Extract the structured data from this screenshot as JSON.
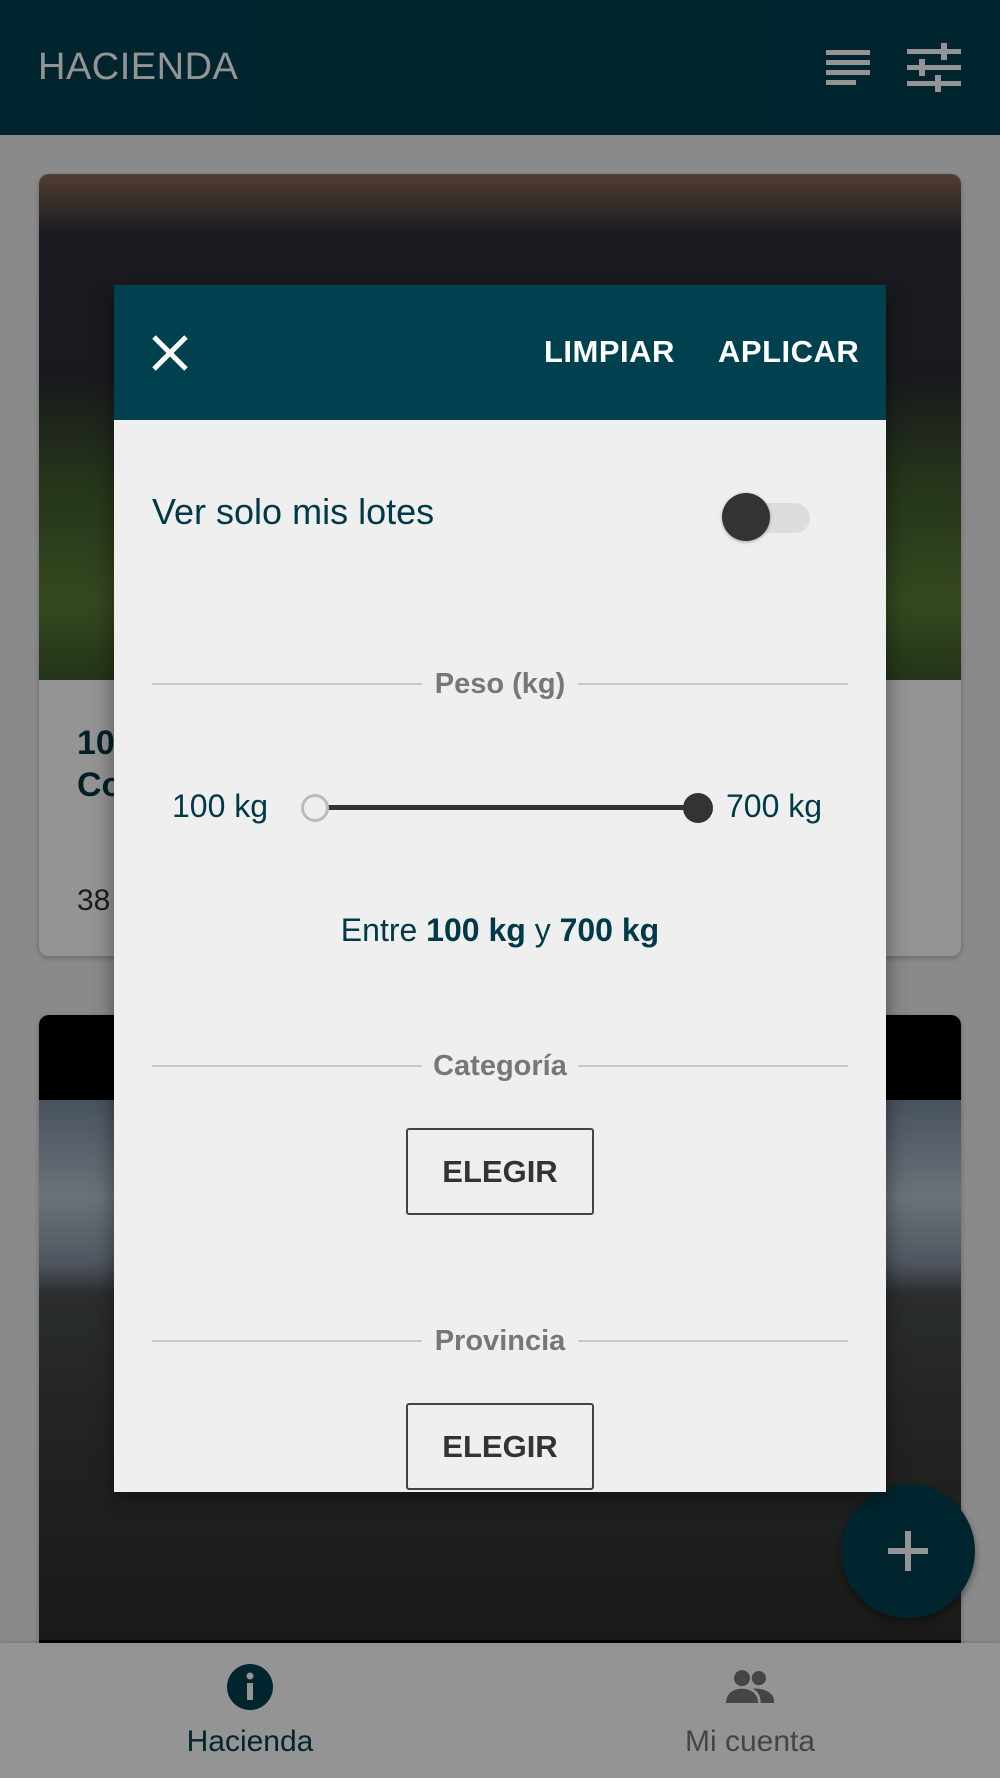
{
  "app_bar": {
    "title": "HACIENDA",
    "icons": [
      "sort-lines-icon",
      "tune-sliders-icon"
    ]
  },
  "cards": [
    {
      "title": "10\nCo",
      "subtitle": "38"
    },
    {
      "title": "",
      "subtitle": ""
    }
  ],
  "dialog": {
    "close_icon": "close-icon",
    "clear_label": "LIMPIAR",
    "apply_label": "APLICAR",
    "toggle": {
      "label": "Ver solo mis lotes",
      "on": false
    },
    "weight": {
      "section_label": "Peso (kg)",
      "min_label": "100 kg",
      "max_label": "700 kg",
      "min_value": 100,
      "max_value": 700,
      "range_prefix": "Entre",
      "range_low": "100 kg",
      "range_joiner": "y",
      "range_high": "700 kg"
    },
    "category": {
      "section_label": "Categoría",
      "button_label": "ELEGIR"
    },
    "province": {
      "section_label": "Provincia",
      "button_label": "ELEGIR"
    }
  },
  "fab": {
    "icon": "plus-icon"
  },
  "bottom_nav": {
    "items": [
      {
        "label": "Hacienda",
        "icon": "info-icon",
        "active": true
      },
      {
        "label": "Mi cuenta",
        "icon": "people-icon",
        "active": false
      }
    ]
  },
  "colors": {
    "primary": "#004150",
    "dialog_bg": "#efefef",
    "text_primary": "#003a48",
    "section_label": "#777777"
  }
}
